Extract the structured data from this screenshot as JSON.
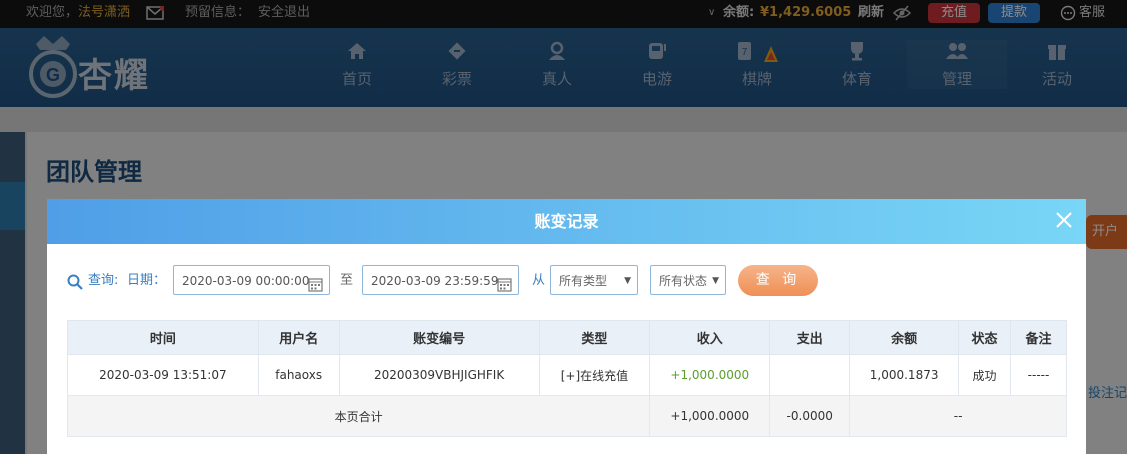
{
  "topbar": {
    "welcome": "欢迎您，",
    "username": "法号潇洒",
    "message_label": "预留信息：",
    "logout": "安全退出",
    "balance_label": "余额:",
    "balance_value": "¥1,429.6005",
    "refresh": "刷新",
    "recharge": "充值",
    "withdraw": "提款",
    "service": "客服"
  },
  "brand": {
    "logo_text": "杏耀"
  },
  "nav": [
    {
      "label": "首页",
      "icon": "home-icon"
    },
    {
      "label": "彩票",
      "icon": "ticket-icon"
    },
    {
      "label": "真人",
      "icon": "live-dealer-icon"
    },
    {
      "label": "电游",
      "icon": "slot-machine-icon"
    },
    {
      "label": "棋牌",
      "icon": "cards-icon"
    },
    {
      "label": "体育",
      "icon": "trophy-icon"
    },
    {
      "label": "管理",
      "icon": "users-icon"
    },
    {
      "label": "活动",
      "icon": "gift-icon"
    }
  ],
  "page": {
    "title": "团队管理",
    "side_button": "开户",
    "side_link": "投注记"
  },
  "modal": {
    "title": "账变记录",
    "filters": {
      "query_label": "查询:",
      "date_label": "日期：",
      "start_date": "2020-03-09 00:00:00",
      "to_label": "至",
      "end_date": "2020-03-09 23:59:59",
      "from_label": "从",
      "type_select": "所有类型",
      "status_select": "所有状态",
      "query_button": "查 询"
    },
    "table": {
      "headers": [
        "时间",
        "用户名",
        "账变编号",
        "类型",
        "收入",
        "支出",
        "余额",
        "状态",
        "备注"
      ],
      "rows": [
        {
          "time": "2020-03-09 13:51:07",
          "user": "fahaoxs",
          "code": "20200309VBHJIGHFIK",
          "type": "[+]在线充值",
          "income": "+1,000.0000",
          "expense": "",
          "balance": "1,000.1873",
          "status": "成功",
          "note": "-----"
        }
      ],
      "summary": {
        "label": "本页合计",
        "income": "+1,000.0000",
        "expense": "-0.0000",
        "rest": "--"
      }
    }
  },
  "colors": {
    "accent_blue": "#3a7fc1",
    "income_green": "#5a9e2c",
    "query_orange": "#ef8f56",
    "balance_gold": "#e5a93a"
  }
}
